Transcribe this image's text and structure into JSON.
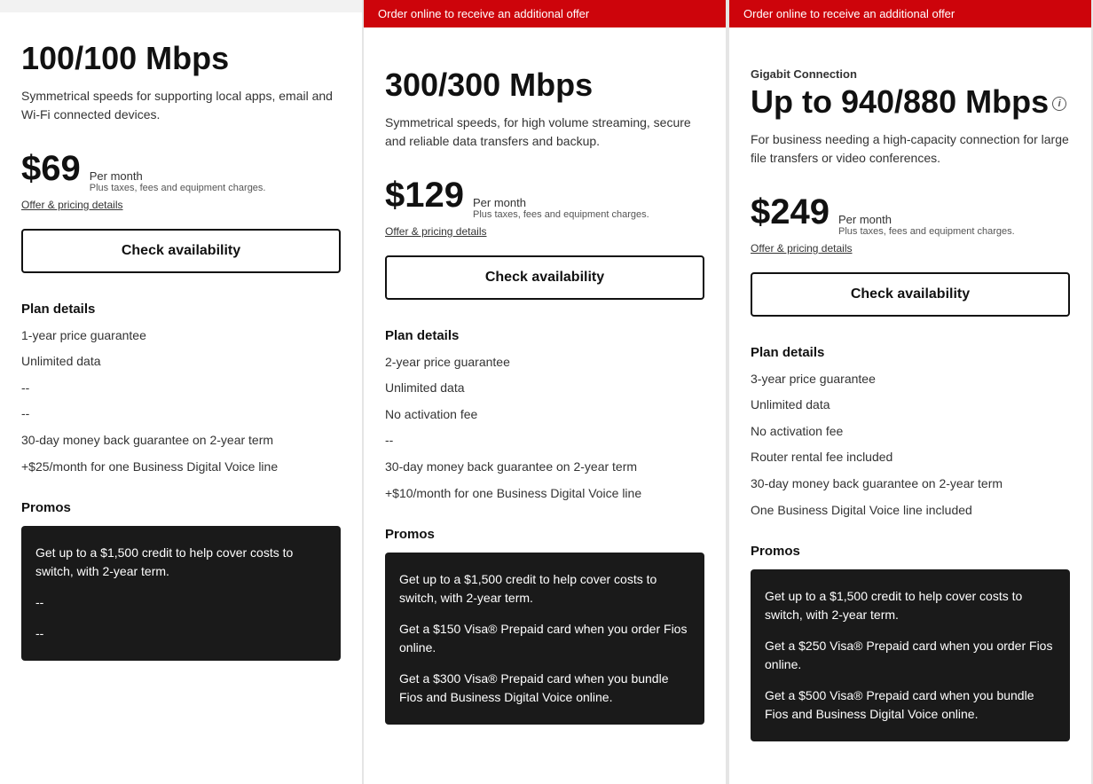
{
  "plans": [
    {
      "id": "plan-100",
      "hasBanner": false,
      "banner": "",
      "tag": "",
      "speed": "100/100 Mbps",
      "description": "Symmetrical speeds for supporting local apps, email and Wi-Fi connected devices.",
      "price": "$69",
      "perMonth": "Per month",
      "taxes": "Plus taxes, fees and equipment charges.",
      "offerLink": "Offer & pricing details",
      "checkBtn": "Check availability",
      "details": {
        "heading": "Plan details",
        "features": [
          "1-year price guarantee",
          "Unlimited data",
          "--",
          "--",
          "30-day money back guarantee on 2-year term",
          "+$25/month for one Business Digital Voice line"
        ]
      },
      "promos": {
        "heading": "Promos",
        "items": [
          "Get up to a $1,500 credit to help cover costs to switch, with 2-year term.",
          "--",
          "--"
        ]
      }
    },
    {
      "id": "plan-300",
      "hasBanner": true,
      "banner": "Order online to receive an additional offer",
      "tag": "",
      "speed": "300/300 Mbps",
      "description": "Symmetrical speeds, for high volume streaming, secure and reliable data transfers and backup.",
      "price": "$129",
      "perMonth": "Per month",
      "taxes": "Plus taxes, fees and equipment charges.",
      "offerLink": "Offer & pricing details",
      "checkBtn": "Check availability",
      "details": {
        "heading": "Plan details",
        "features": [
          "2-year price guarantee",
          "Unlimited data",
          "No activation fee",
          "--",
          "30-day money back guarantee on 2-year term",
          "+$10/month for one Business Digital Voice line"
        ]
      },
      "promos": {
        "heading": "Promos",
        "items": [
          "Get up to a $1,500 credit to help cover costs to switch, with 2-year term.",
          "Get a $150 Visa® Prepaid card when you order Fios online.",
          "Get a $300 Visa® Prepaid card when you bundle Fios and Business Digital Voice online."
        ]
      }
    },
    {
      "id": "plan-940",
      "hasBanner": true,
      "banner": "Order online to receive an additional offer",
      "tag": "Gigabit Connection",
      "speed": "Up to 940/880 Mbps",
      "description": "For business needing a high-capacity connection for large file transfers or video conferences.",
      "price": "$249",
      "perMonth": "Per month",
      "taxes": "Plus taxes, fees and equipment charges.",
      "offerLink": "Offer & pricing details",
      "checkBtn": "Check availability",
      "details": {
        "heading": "Plan details",
        "features": [
          "3-year price guarantee",
          "Unlimited data",
          "No activation fee",
          "Router rental fee included",
          "30-day money back guarantee on 2-year term",
          "One Business Digital Voice line included"
        ]
      },
      "promos": {
        "heading": "Promos",
        "items": [
          "Get up to a $1,500 credit to help cover costs to switch, with 2-year term.",
          "Get a $250 Visa® Prepaid card when you order Fios online.",
          "Get a $500 Visa® Prepaid card when you bundle Fios and Business Digital Voice online."
        ]
      }
    }
  ]
}
